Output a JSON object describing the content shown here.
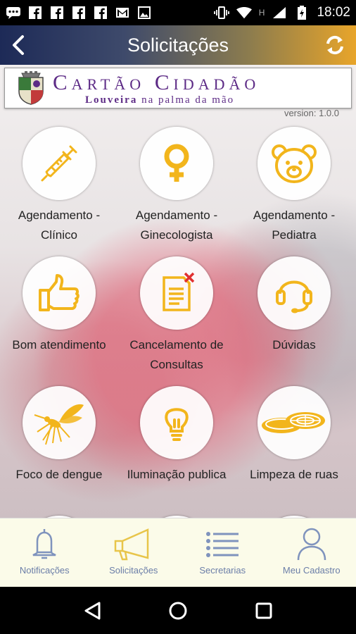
{
  "status_bar": {
    "time": "18:02",
    "h_indicator": "H",
    "left_icons": [
      "message-icon",
      "facebook-icon",
      "facebook-icon",
      "facebook-icon",
      "facebook-icon",
      "gmail-icon",
      "image-icon"
    ],
    "right_icons": [
      "vibrate-icon",
      "wifi-icon",
      "signal-icon",
      "battery-icon"
    ]
  },
  "app_bar": {
    "title": "Solicitações"
  },
  "banner": {
    "title": "Cartão Cidadão",
    "subtitle_bold": "Louveira",
    "subtitle_rest": " na palma da mão"
  },
  "version": "version: 1.0.0",
  "services": [
    {
      "label": "Agendamento - Clínico",
      "icon": "syringe-icon"
    },
    {
      "label": "Agendamento - Ginecologista",
      "icon": "female-symbol-icon"
    },
    {
      "label": "Agendamento - Pediatra",
      "icon": "teddy-bear-icon"
    },
    {
      "label": "Bom atendimento",
      "icon": "thumbs-up-icon"
    },
    {
      "label": "Cancelamento de Consultas",
      "icon": "cancel-document-icon"
    },
    {
      "label": "Dúvidas",
      "icon": "headset-icon"
    },
    {
      "label": "Foco de dengue",
      "icon": "mosquito-icon"
    },
    {
      "label": "Iluminação publica",
      "icon": "lightbulb-icon"
    },
    {
      "label": "Limpeza de ruas",
      "icon": "manhole-icon"
    }
  ],
  "bottom_nav": {
    "items": [
      {
        "label": "Notificações",
        "icon": "bell-icon"
      },
      {
        "label": "Solicitações",
        "icon": "megaphone-icon"
      },
      {
        "label": "Secretarias",
        "icon": "list-icon"
      },
      {
        "label": "Meu Cadastro",
        "icon": "user-icon"
      }
    ]
  },
  "colors": {
    "accent": "#f2b51c",
    "appbar_left": "#1d2a57",
    "appbar_right": "#e8a52a",
    "brand_purple": "#5d2b86",
    "nav_icon": "#6b7ea8",
    "nav_icon_active": "#e8c54a"
  }
}
